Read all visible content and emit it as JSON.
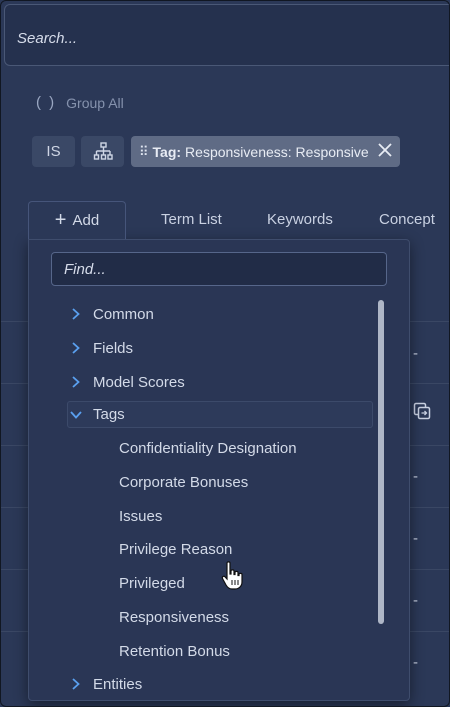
{
  "search": {
    "placeholder": "Search..."
  },
  "group_all": {
    "paren": "( )",
    "label": "Group All"
  },
  "toolbar": {
    "is_label": "IS",
    "tag_chip": {
      "key": "Tag:",
      "value": "Responsiveness: Responsive"
    }
  },
  "tabs": {
    "add_label": "Add",
    "term_list": "Term List",
    "keywords": "Keywords",
    "concept": "Concept"
  },
  "background_rows": {
    "dash": "-"
  },
  "dropdown": {
    "find_placeholder": "Find...",
    "items": [
      {
        "label": "Common"
      },
      {
        "label": "Fields"
      },
      {
        "label": "Model Scores"
      },
      {
        "label": "Tags"
      },
      {
        "label": "Entities"
      }
    ],
    "tag_children": [
      "Confidentiality Designation",
      "Corporate Bonuses",
      "Issues",
      "Privilege Reason",
      "Privileged",
      "Responsiveness",
      "Retention Bonus"
    ]
  },
  "colors": {
    "background": "#2b3857",
    "chip": "#5f6b85",
    "accent": "#4a90e2"
  }
}
